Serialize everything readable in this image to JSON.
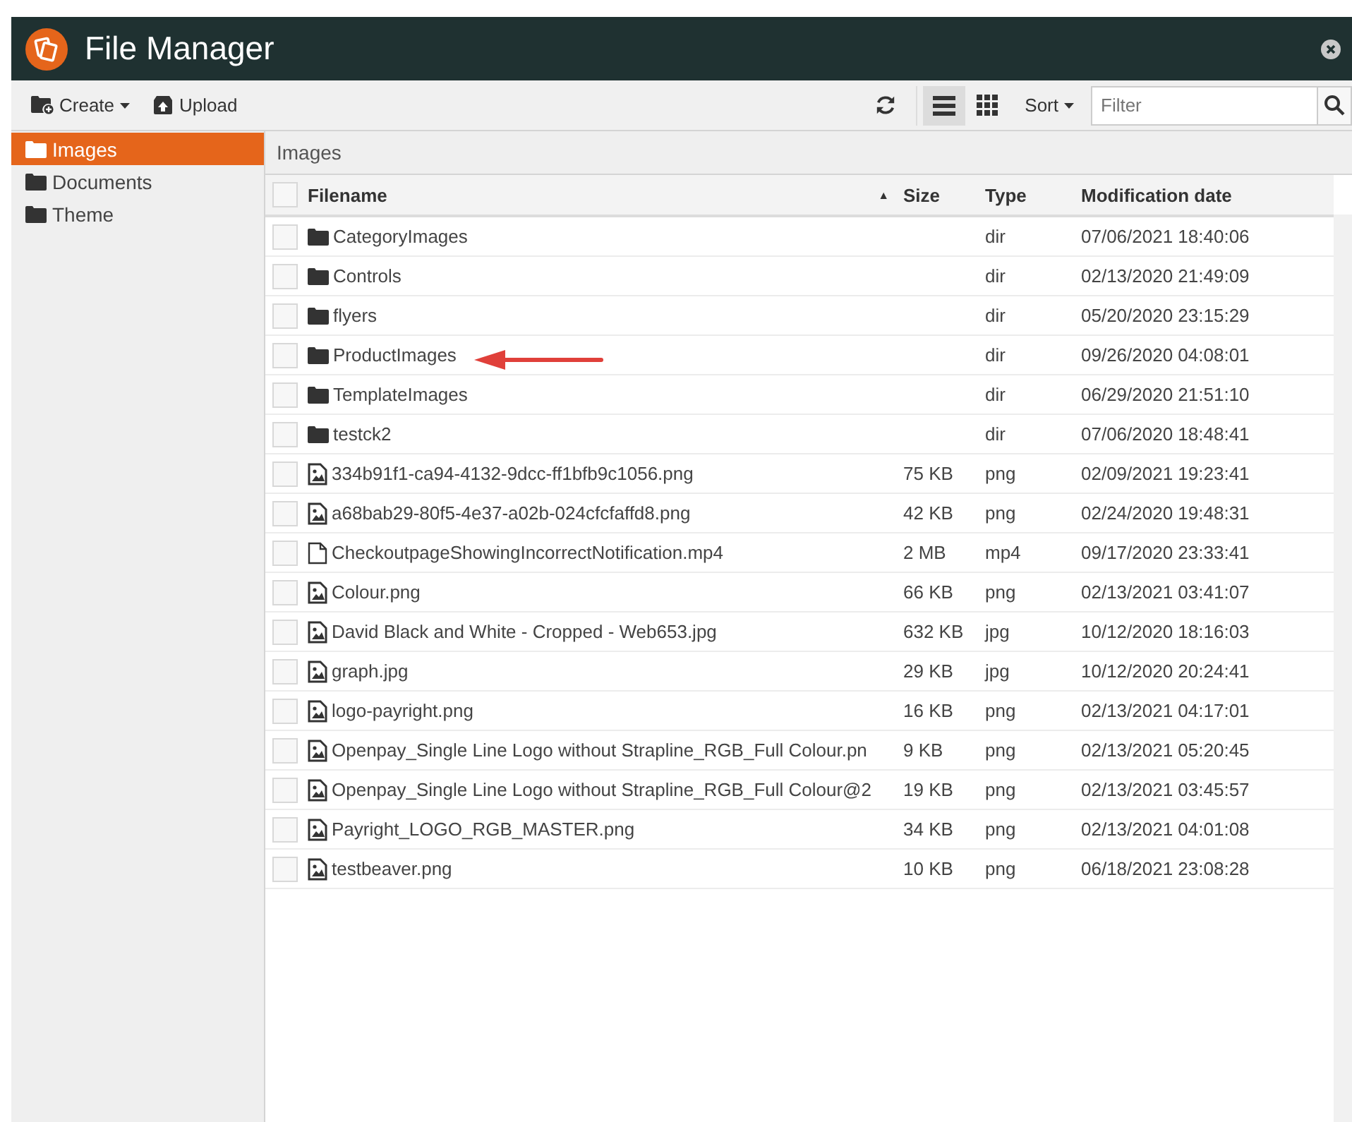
{
  "window": {
    "title": "File Manager"
  },
  "toolbar": {
    "create": "Create",
    "upload": "Upload",
    "views": [
      {
        "kind": "list",
        "selected": true
      },
      {
        "kind": "grid",
        "selected": false
      }
    ],
    "sort": "Sort",
    "filter": {
      "placeholder": "Filter"
    }
  },
  "sidebar": {
    "items": [
      {
        "label": "Images",
        "selected": true
      },
      {
        "label": "Documents",
        "selected": false
      },
      {
        "label": "Theme",
        "selected": false
      }
    ]
  },
  "breadcrumb": "Images",
  "table": {
    "select_all": {
      "checked": false
    },
    "columns": [
      "Filename",
      "Size",
      "Type",
      "Modification date"
    ],
    "sort_indicator": "▲",
    "rows": [
      {
        "kind": "dir",
        "name": "CategoryImages",
        "size": "",
        "type": "dir",
        "date": "07/06/2021 18:40:06",
        "checked": false
      },
      {
        "kind": "dir",
        "name": "Controls",
        "size": "",
        "type": "dir",
        "date": "02/13/2020 21:49:09",
        "checked": false
      },
      {
        "kind": "dir",
        "name": "flyers",
        "size": "",
        "type": "dir",
        "date": "05/20/2020 23:15:29",
        "checked": false
      },
      {
        "kind": "dir",
        "name": "ProductImages",
        "size": "",
        "type": "dir",
        "date": "09/26/2020 04:08:01",
        "checked": false
      },
      {
        "kind": "dir",
        "name": "TemplateImages",
        "size": "",
        "type": "dir",
        "date": "06/29/2020 21:51:10",
        "checked": false
      },
      {
        "kind": "dir",
        "name": "testck2",
        "size": "",
        "type": "dir",
        "date": "07/06/2020 18:48:41",
        "checked": false
      },
      {
        "kind": "image",
        "name": "334b91f1-ca94-4132-9dcc-ff1bfb9c1056.png",
        "size": "75 KB",
        "type": "png",
        "date": "02/09/2021 19:23:41",
        "checked": false
      },
      {
        "kind": "image",
        "name": "a68bab29-80f5-4e37-a02b-024cfcfaffd8.png",
        "size": "42 KB",
        "type": "png",
        "date": "02/24/2020 19:48:31",
        "checked": false
      },
      {
        "kind": "file",
        "name": "CheckoutpageShowingIncorrectNotification.mp4",
        "size": "2 MB",
        "type": "mp4",
        "date": "09/17/2020 23:33:41",
        "checked": false
      },
      {
        "kind": "image",
        "name": "Colour.png",
        "size": "66 KB",
        "type": "png",
        "date": "02/13/2021 03:41:07",
        "checked": false
      },
      {
        "kind": "image",
        "name": "David Black and White - Cropped - Web653.jpg",
        "size": "632 KB",
        "type": "jpg",
        "date": "10/12/2020 18:16:03",
        "checked": false
      },
      {
        "kind": "image",
        "name": "graph.jpg",
        "size": "29 KB",
        "type": "jpg",
        "date": "10/12/2020 20:24:41",
        "checked": false
      },
      {
        "kind": "image",
        "name": "logo-payright.png",
        "size": "16 KB",
        "type": "png",
        "date": "02/13/2021 04:17:01",
        "checked": false
      },
      {
        "kind": "image",
        "name": "Openpay_Single Line Logo without Strapline_RGB_Full Colour.pn",
        "size": "9 KB",
        "type": "png",
        "date": "02/13/2021 05:20:45",
        "checked": false
      },
      {
        "kind": "image",
        "name": "Openpay_Single Line Logo without Strapline_RGB_Full Colour@2",
        "size": "19 KB",
        "type": "png",
        "date": "02/13/2021 03:45:57",
        "checked": false
      },
      {
        "kind": "image",
        "name": "Payright_LOGO_RGB_MASTER.png",
        "size": "34 KB",
        "type": "png",
        "date": "02/13/2021 04:01:08",
        "checked": false
      },
      {
        "kind": "image",
        "name": "testbeaver.png",
        "size": "10 KB",
        "type": "png",
        "date": "06/18/2021 23:08:28",
        "checked": false
      }
    ]
  }
}
